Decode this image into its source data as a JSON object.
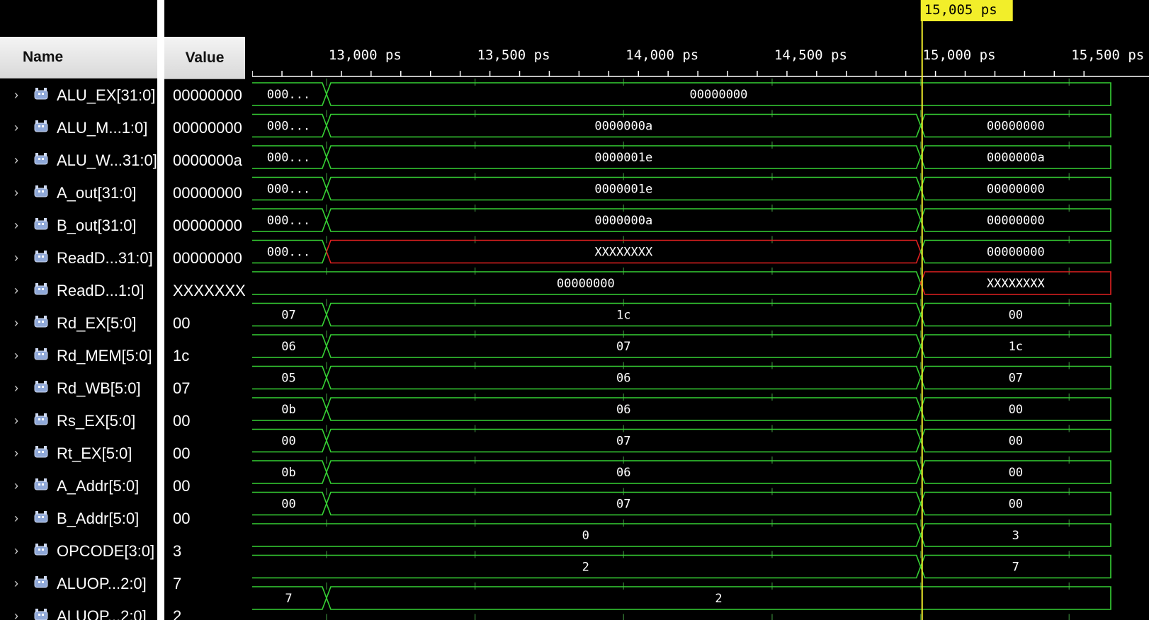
{
  "columns": {
    "name_header": "Name",
    "value_header": "Value"
  },
  "colors": {
    "wave": "#36d134",
    "unknown": "#e02020",
    "cursor": "#f2ee2a",
    "grid": "#2d6a2d",
    "ruler": "#ffffff"
  },
  "ruler": {
    "labels": [
      {
        "time": 13000,
        "text": "13,000 ps"
      },
      {
        "time": 13500,
        "text": "13,500 ps"
      },
      {
        "time": 14000,
        "text": "14,000 ps"
      },
      {
        "time": 14500,
        "text": "14,500 ps"
      },
      {
        "time": 15000,
        "text": "15,000 ps"
      },
      {
        "time": 15500,
        "text": "15,500 ps"
      }
    ],
    "view_start": 12745,
    "view_end": 15640
  },
  "cursor": {
    "time": 15005,
    "label": "15,005 ps"
  },
  "signals": [
    {
      "name": "ALU_EX[31:0]",
      "value": "00000000",
      "segments": [
        {
          "t0": 12745,
          "t1": 13000,
          "text": "000...",
          "unknown": false
        },
        {
          "t0": 13000,
          "t1": 15640,
          "text": "00000000",
          "unknown": false
        }
      ]
    },
    {
      "name": "ALU_M...1:0]",
      "value": "00000000",
      "segments": [
        {
          "t0": 12745,
          "t1": 13000,
          "text": "000...",
          "unknown": false
        },
        {
          "t0": 13000,
          "t1": 15000,
          "text": "0000000a",
          "unknown": false
        },
        {
          "t0": 15000,
          "t1": 15640,
          "text": "00000000",
          "unknown": false
        }
      ]
    },
    {
      "name": "ALU_W...31:0]",
      "value": "0000000a",
      "segments": [
        {
          "t0": 12745,
          "t1": 13000,
          "text": "000...",
          "unknown": false
        },
        {
          "t0": 13000,
          "t1": 15000,
          "text": "0000001e",
          "unknown": false
        },
        {
          "t0": 15000,
          "t1": 15640,
          "text": "0000000a",
          "unknown": false
        }
      ]
    },
    {
      "name": "A_out[31:0]",
      "value": "00000000",
      "segments": [
        {
          "t0": 12745,
          "t1": 13000,
          "text": "000...",
          "unknown": false
        },
        {
          "t0": 13000,
          "t1": 15000,
          "text": "0000001e",
          "unknown": false
        },
        {
          "t0": 15000,
          "t1": 15640,
          "text": "00000000",
          "unknown": false
        }
      ]
    },
    {
      "name": "B_out[31:0]",
      "value": "00000000",
      "segments": [
        {
          "t0": 12745,
          "t1": 13000,
          "text": "000...",
          "unknown": false
        },
        {
          "t0": 13000,
          "t1": 15000,
          "text": "0000000a",
          "unknown": false
        },
        {
          "t0": 15000,
          "t1": 15640,
          "text": "00000000",
          "unknown": false
        }
      ]
    },
    {
      "name": "ReadD...31:0]",
      "value": "00000000",
      "segments": [
        {
          "t0": 12745,
          "t1": 13000,
          "text": "000...",
          "unknown": false
        },
        {
          "t0": 13000,
          "t1": 15000,
          "text": "XXXXXXXX",
          "unknown": true
        },
        {
          "t0": 15000,
          "t1": 15640,
          "text": "00000000",
          "unknown": false
        }
      ]
    },
    {
      "name": "ReadD...1:0]",
      "value": "XXXXXXXX",
      "segments": [
        {
          "t0": 12745,
          "t1": 15000,
          "text": "00000000",
          "unknown": false
        },
        {
          "t0": 15000,
          "t1": 15640,
          "text": "XXXXXXXX",
          "unknown": true
        }
      ]
    },
    {
      "name": "Rd_EX[5:0]",
      "value": "00",
      "segments": [
        {
          "t0": 12745,
          "t1": 13000,
          "text": "07",
          "unknown": false
        },
        {
          "t0": 13000,
          "t1": 15000,
          "text": "1c",
          "unknown": false
        },
        {
          "t0": 15000,
          "t1": 15640,
          "text": "00",
          "unknown": false
        }
      ]
    },
    {
      "name": "Rd_MEM[5:0]",
      "value": "1c",
      "segments": [
        {
          "t0": 12745,
          "t1": 13000,
          "text": "06",
          "unknown": false
        },
        {
          "t0": 13000,
          "t1": 15000,
          "text": "07",
          "unknown": false
        },
        {
          "t0": 15000,
          "t1": 15640,
          "text": "1c",
          "unknown": false
        }
      ]
    },
    {
      "name": "Rd_WB[5:0]",
      "value": "07",
      "segments": [
        {
          "t0": 12745,
          "t1": 13000,
          "text": "05",
          "unknown": false
        },
        {
          "t0": 13000,
          "t1": 15000,
          "text": "06",
          "unknown": false
        },
        {
          "t0": 15000,
          "t1": 15640,
          "text": "07",
          "unknown": false
        }
      ]
    },
    {
      "name": "Rs_EX[5:0]",
      "value": "00",
      "segments": [
        {
          "t0": 12745,
          "t1": 13000,
          "text": "0b",
          "unknown": false
        },
        {
          "t0": 13000,
          "t1": 15000,
          "text": "06",
          "unknown": false
        },
        {
          "t0": 15000,
          "t1": 15640,
          "text": "00",
          "unknown": false
        }
      ]
    },
    {
      "name": "Rt_EX[5:0]",
      "value": "00",
      "segments": [
        {
          "t0": 12745,
          "t1": 13000,
          "text": "00",
          "unknown": false
        },
        {
          "t0": 13000,
          "t1": 15000,
          "text": "07",
          "unknown": false
        },
        {
          "t0": 15000,
          "t1": 15640,
          "text": "00",
          "unknown": false
        }
      ]
    },
    {
      "name": "A_Addr[5:0]",
      "value": "00",
      "segments": [
        {
          "t0": 12745,
          "t1": 13000,
          "text": "0b",
          "unknown": false
        },
        {
          "t0": 13000,
          "t1": 15000,
          "text": "06",
          "unknown": false
        },
        {
          "t0": 15000,
          "t1": 15640,
          "text": "00",
          "unknown": false
        }
      ]
    },
    {
      "name": "B_Addr[5:0]",
      "value": "00",
      "segments": [
        {
          "t0": 12745,
          "t1": 13000,
          "text": "00",
          "unknown": false
        },
        {
          "t0": 13000,
          "t1": 15000,
          "text": "07",
          "unknown": false
        },
        {
          "t0": 15000,
          "t1": 15640,
          "text": "00",
          "unknown": false
        }
      ]
    },
    {
      "name": "OPCODE[3:0]",
      "value": "3",
      "segments": [
        {
          "t0": 12745,
          "t1": 15000,
          "text": "0",
          "unknown": false
        },
        {
          "t0": 15000,
          "t1": 15640,
          "text": "3",
          "unknown": false
        }
      ]
    },
    {
      "name": "ALUOP...2:0]",
      "value": "7",
      "segments": [
        {
          "t0": 12745,
          "t1": 15000,
          "text": "2",
          "unknown": false
        },
        {
          "t0": 15000,
          "t1": 15640,
          "text": "7",
          "unknown": false
        }
      ]
    },
    {
      "name": "ALUOP...2:0]",
      "value": "2",
      "segments": [
        {
          "t0": 12745,
          "t1": 13000,
          "text": "7",
          "unknown": false
        },
        {
          "t0": 13000,
          "t1": 15640,
          "text": "2",
          "unknown": false
        }
      ]
    }
  ]
}
